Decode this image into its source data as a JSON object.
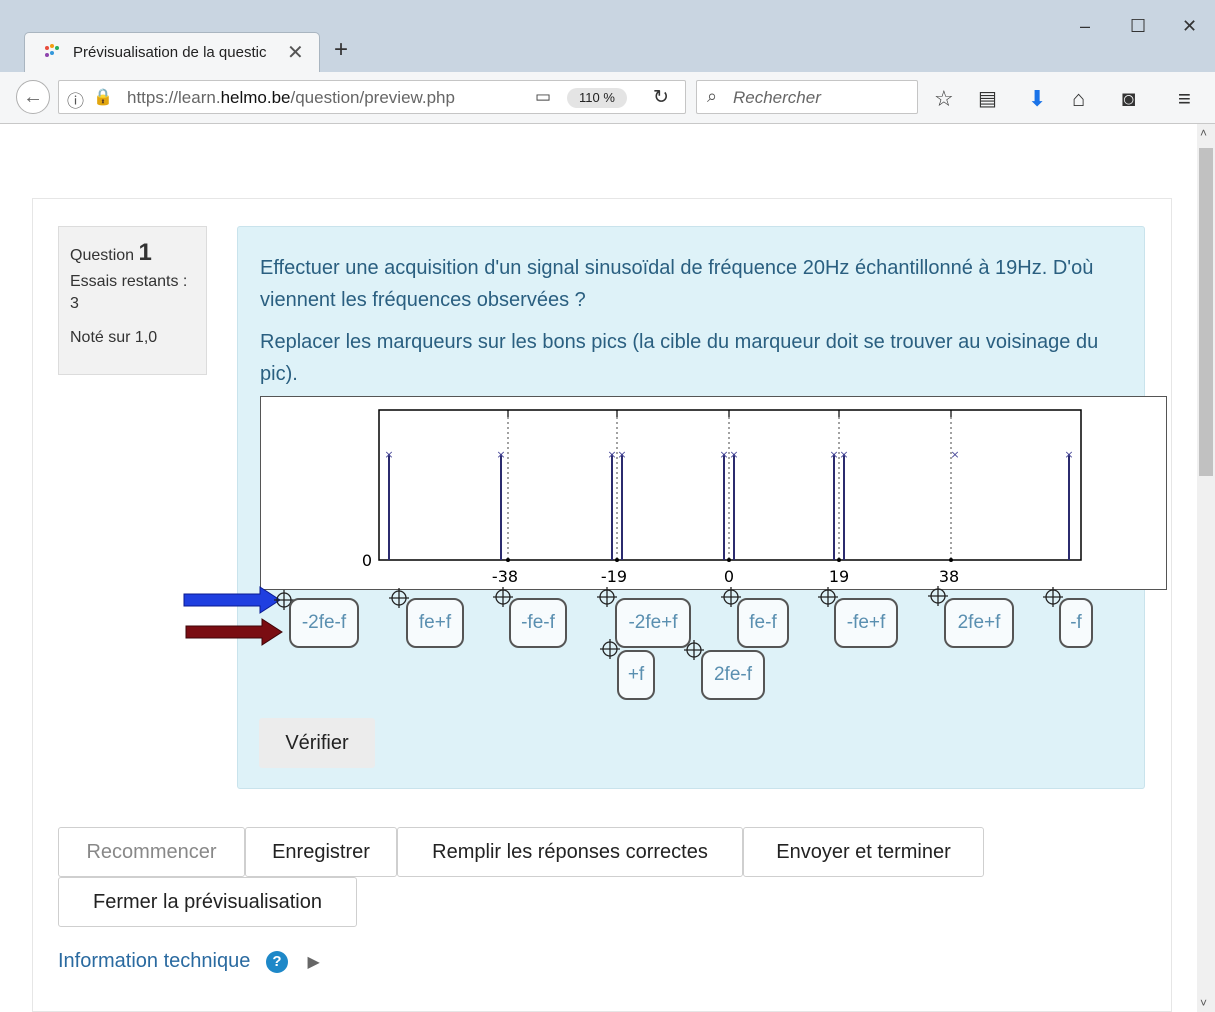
{
  "browser": {
    "tab_title": "Prévisualisation de la questic",
    "url_host_prefix": "https://learn.",
    "url_host_bold": "helmo.be",
    "url_path": "/question/preview.php",
    "zoom": "110 %",
    "search_placeholder": "Rechercher"
  },
  "question": {
    "label": "Question",
    "number": "1",
    "attempts_label": "Essais restants :",
    "attempts_value": "3",
    "marks": "Noté sur 1,0",
    "text_1": "Effectuer une acquisition d'un signal sinusoïdal de fréquence 20Hz échantillonné à 19Hz. D'où viennent les fréquences observées ?",
    "text_2": "Replacer les marqueurs sur les bons pics (la cible du marqueur doit se trouver au voisinage du pic).",
    "verify_label": "Vérifier"
  },
  "plot": {
    "y_tick": "0",
    "x_ticks": [
      "-38",
      "-19",
      "0",
      "19",
      "38"
    ]
  },
  "chart_data": {
    "type": "line",
    "x_ticks": [
      -38,
      -19,
      0,
      19,
      38
    ],
    "y_ticks": [
      0
    ]
  },
  "markers": [
    "-2fe-f",
    "fe+f",
    "-fe-f",
    "-2fe+f",
    "fe-f",
    "-fe+f",
    "2fe+f",
    "-f",
    "+f",
    "2fe-f"
  ],
  "buttons": {
    "restart": "Recommencer",
    "save": "Enregistrer",
    "fill_correct": "Remplir les réponses correctes",
    "submit": "Envoyer et terminer",
    "close_preview": "Fermer la prévisualisation"
  },
  "technical_info": "Information technique",
  "colors": {
    "arrow_blue": "#1f3fe0",
    "arrow_red": "#7a0d12"
  }
}
